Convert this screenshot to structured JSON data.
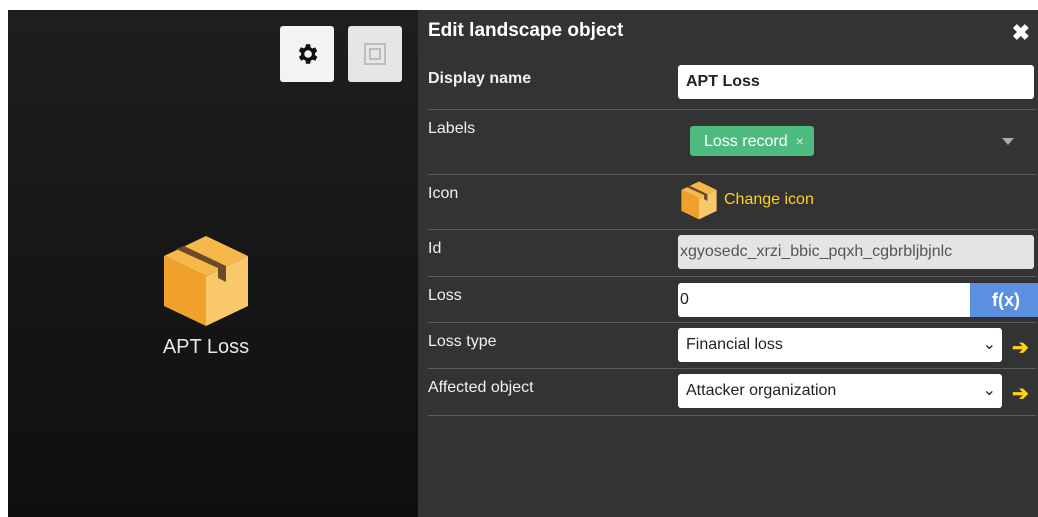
{
  "canvas": {
    "node_label": "APT Loss",
    "settings_icon": "gear-icon",
    "fit_icon": "fit-view-icon",
    "node_icon": "package-box-icon"
  },
  "panel": {
    "title": "Edit landscape object",
    "close_symbol": "✖",
    "fields": {
      "display_name": {
        "label": "Display name",
        "value": "APT Loss"
      },
      "labels": {
        "label": "Labels",
        "tags": [
          {
            "text": "Loss record",
            "remove": "×",
            "color": "#4dbb7f"
          }
        ]
      },
      "icon": {
        "label": "Icon",
        "link": "Change icon"
      },
      "id": {
        "label": "Id",
        "value": "xgyosedc_xrzi_bbic_pqxh_cgbrbljbjnlc"
      },
      "loss": {
        "label": "Loss",
        "value": "0",
        "fx_label": "f(x)"
      },
      "loss_type": {
        "label": "Loss type",
        "value": "Financial loss",
        "arrow": "➔"
      },
      "affected_object": {
        "label": "Affected object",
        "value": "Attacker organization",
        "arrow": "➔"
      }
    }
  },
  "colors": {
    "panel_bg": "#333333",
    "accent_yellow": "#ffd21a",
    "tag_green": "#4dbb7f",
    "fx_blue": "#5b8fe0"
  }
}
